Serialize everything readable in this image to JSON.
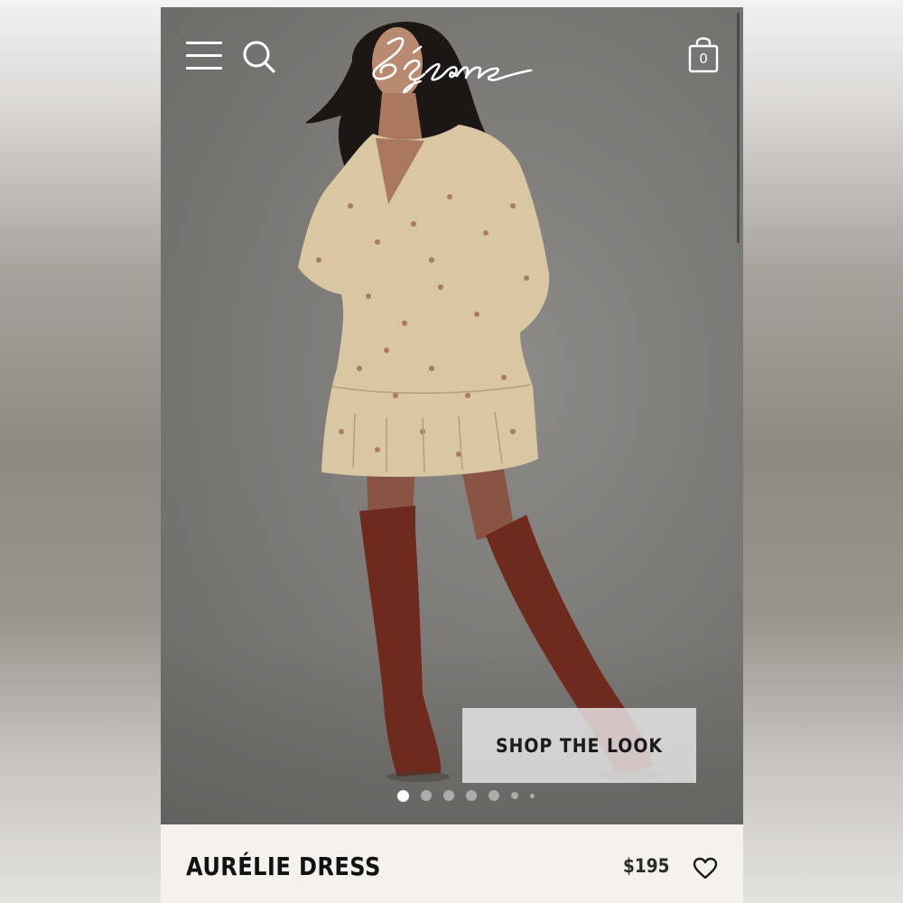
{
  "header": {
    "brand": "Sézane",
    "cart_count": "0"
  },
  "hero": {
    "cta_label": "SHOP THE LOOK",
    "carousel": {
      "slide_count": 7,
      "active_index": 0
    }
  },
  "product": {
    "name": "AURÉLIE DRESS",
    "price": "$195"
  },
  "icons": {
    "menu": "hamburger-menu-icon",
    "search": "search-icon",
    "cart": "shopping-bag-icon",
    "wishlist": "heart-icon"
  },
  "colors": {
    "backdrop": "#7d7b78",
    "dress": "#d9c7a4",
    "boots": "#6e2a1c",
    "info_bar": "#f5f2ed",
    "header_icons": "#ffffff"
  }
}
